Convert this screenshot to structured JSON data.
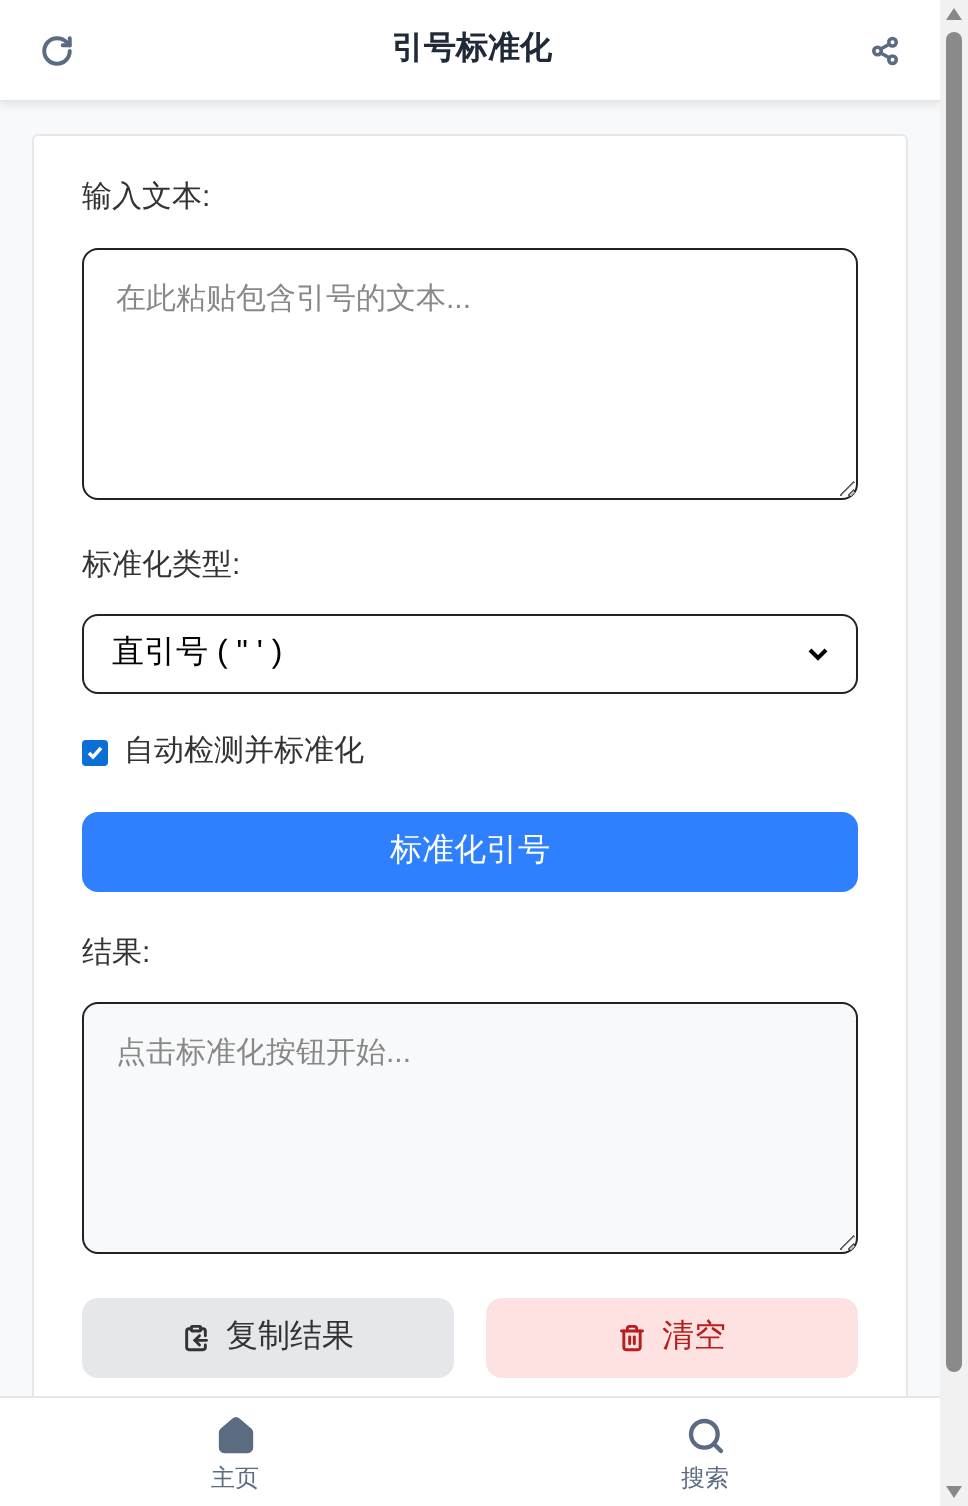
{
  "header": {
    "title": "引号标准化"
  },
  "input": {
    "label": "输入文本:",
    "placeholder": "在此粘贴包含引号的文本..."
  },
  "type_select": {
    "label": "标准化类型:",
    "value": "直引号 ( \" ' )"
  },
  "auto_detect": {
    "label": "自动检测并标准化",
    "checked": true
  },
  "normalize_button": "标准化引号",
  "result": {
    "label": "结果:",
    "placeholder": "点击标准化按钮开始..."
  },
  "actions": [
    {
      "kind": "copy",
      "label": "复制结果"
    },
    {
      "kind": "clear",
      "label": "清空"
    }
  ],
  "bottom_nav": [
    {
      "kind": "home",
      "label": "主页"
    },
    {
      "kind": "search",
      "label": "搜索"
    }
  ]
}
